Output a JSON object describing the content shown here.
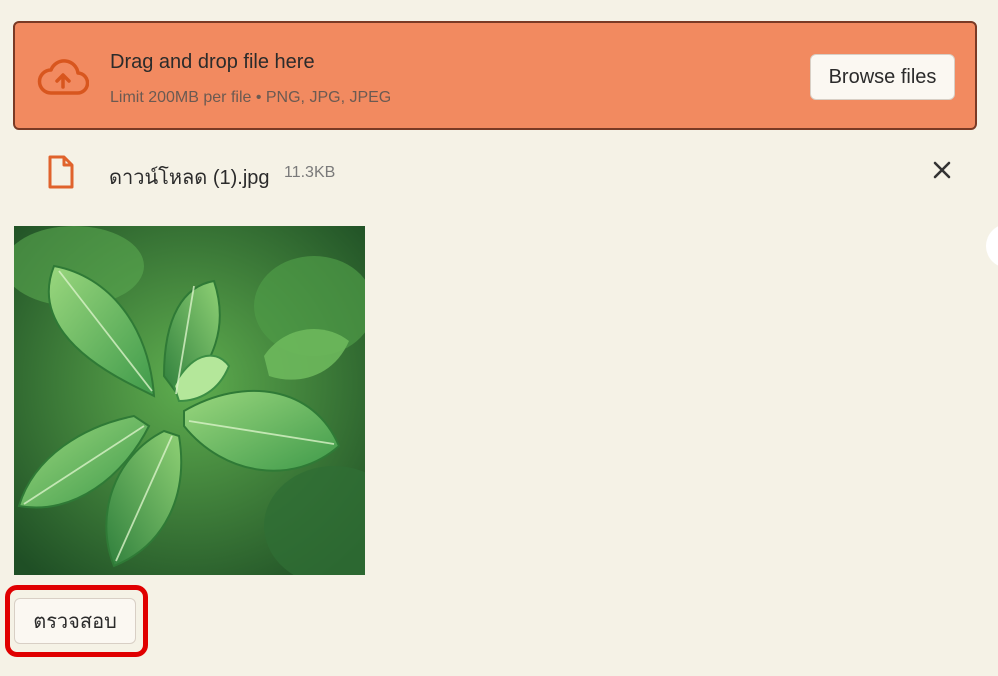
{
  "uploader": {
    "title": "Drag and drop file here",
    "subtitle": "Limit 200MB per file • PNG, JPG, JPEG",
    "browse_label": "Browse files",
    "icon": "cloud-upload-icon",
    "accent_color": "#f28a60"
  },
  "file": {
    "name": "ดาวน์โหลด (1).jpg",
    "size": "11.3KB",
    "icon": "file-icon",
    "remove_icon": "close-icon"
  },
  "preview": {
    "image": "mint-leaves-photo"
  },
  "actions": {
    "check_label": "ตรวจสอบ",
    "highlight_color": "#e00000"
  }
}
